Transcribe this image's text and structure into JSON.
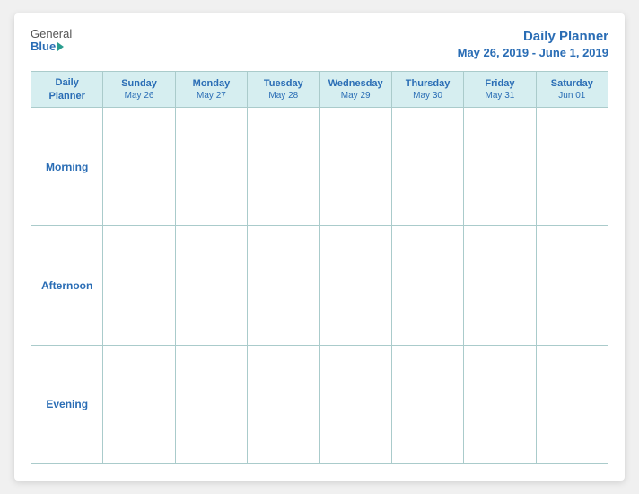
{
  "header": {
    "logo": {
      "general_text": "General",
      "blue_text": "Blue"
    },
    "title": "Daily Planner",
    "date_range": "May 26, 2019 - June 1, 2019"
  },
  "table": {
    "header_col0": {
      "line1": "Daily",
      "line2": "Planner"
    },
    "columns": [
      {
        "day": "Sunday",
        "date": "May 26"
      },
      {
        "day": "Monday",
        "date": "May 27"
      },
      {
        "day": "Tuesday",
        "date": "May 28"
      },
      {
        "day": "Wednesday",
        "date": "May 29"
      },
      {
        "day": "Thursday",
        "date": "May 30"
      },
      {
        "day": "Friday",
        "date": "May 31"
      },
      {
        "day": "Saturday",
        "date": "Jun 01"
      }
    ],
    "rows": [
      {
        "label": "Morning"
      },
      {
        "label": "Afternoon"
      },
      {
        "label": "Evening"
      }
    ]
  }
}
